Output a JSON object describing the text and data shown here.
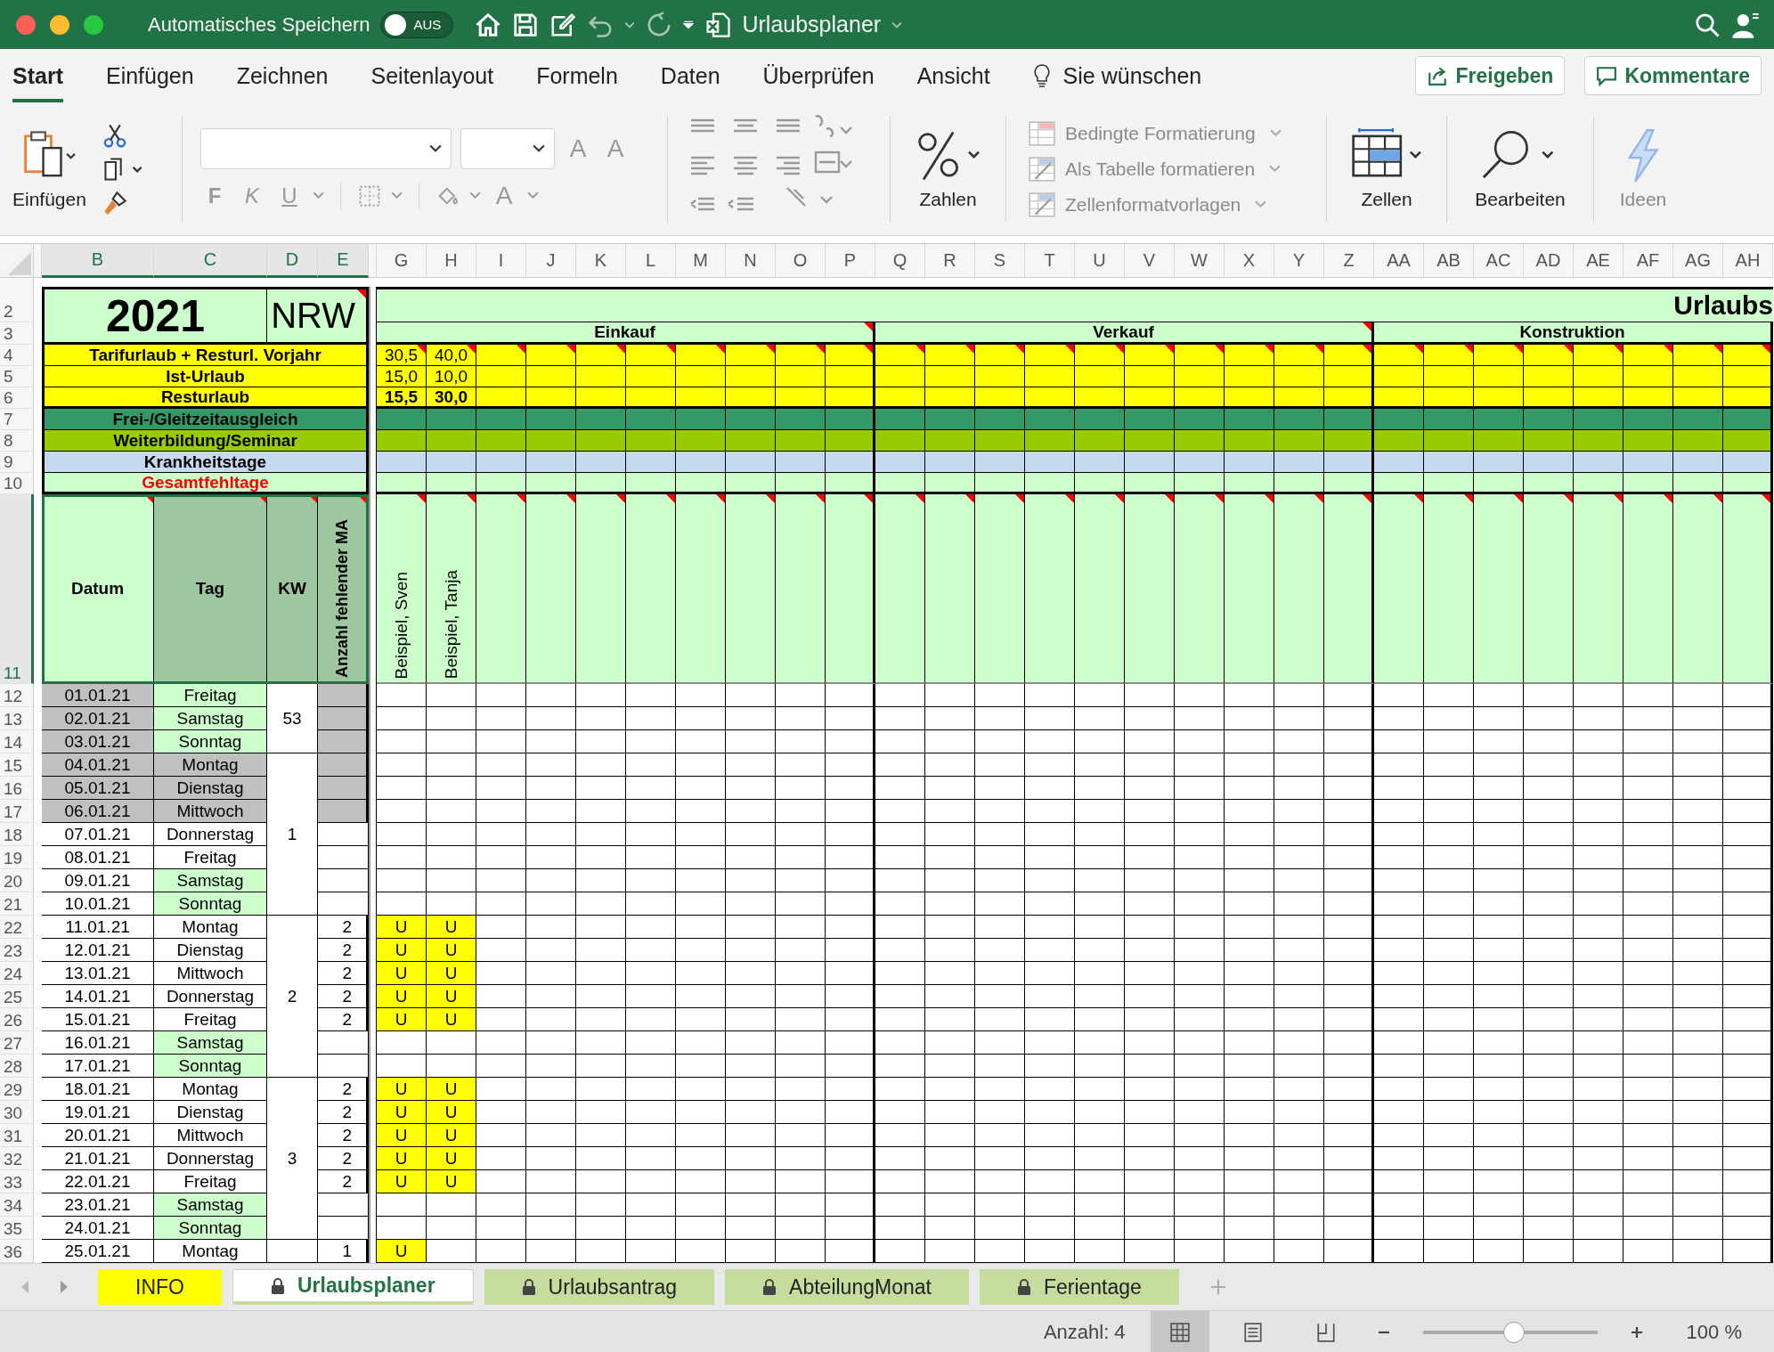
{
  "title_bar": {
    "autosave_label": "Automatisches Speichern",
    "autosave_toggle": {
      "label": "AUS",
      "on": false
    },
    "document_title": "Urlaubsplaner"
  },
  "ribbon_tabs": [
    {
      "label": "Start",
      "selected": true
    },
    {
      "label": "Einfügen",
      "selected": false
    },
    {
      "label": "Zeichnen",
      "selected": false
    },
    {
      "label": "Seitenlayout",
      "selected": false
    },
    {
      "label": "Formeln",
      "selected": false
    },
    {
      "label": "Daten",
      "selected": false
    },
    {
      "label": "Überprüfen",
      "selected": false
    },
    {
      "label": "Ansicht",
      "selected": false
    }
  ],
  "tell_me": "Sie wünschen",
  "share_button": "Freigeben",
  "comments_button": "Kommentare",
  "ribbon": {
    "format_controls_disabled": true,
    "paste_label": "Einfügen",
    "font_style_buttons": [
      "F",
      "K",
      "U"
    ],
    "font_size_buttons": [
      "A",
      "A"
    ],
    "font_color_button": "A",
    "number_label": "Zahlen",
    "styles": [
      "Bedingte Formatierung",
      "Als Tabelle formatieren",
      "Zellenformatvorlagen"
    ],
    "cells_label": "Zellen",
    "edit_label": "Bearbeiten",
    "ideas": {
      "label": "Ideen",
      "disabled": true
    }
  },
  "sheet": {
    "columns": [
      {
        "selected": false
      },
      {
        "letter": "B",
        "selected": true
      },
      {
        "letter": "C",
        "selected": true
      },
      {
        "letter": "D",
        "selected": true
      },
      {
        "letter": "E",
        "selected": true
      },
      {
        "selected": false
      },
      {
        "letter": "G",
        "selected": false
      },
      {
        "letter": "H",
        "selected": false
      },
      {
        "letter": "I",
        "selected": false
      },
      {
        "letter": "J",
        "selected": false
      },
      {
        "letter": "K",
        "selected": false
      },
      {
        "letter": "L",
        "selected": false
      },
      {
        "letter": "M",
        "selected": false
      },
      {
        "letter": "N",
        "selected": false
      },
      {
        "letter": "O",
        "selected": false
      },
      {
        "letter": "P",
        "selected": false
      },
      {
        "letter": "Q",
        "selected": false
      },
      {
        "letter": "R",
        "selected": false
      },
      {
        "letter": "S",
        "selected": false
      },
      {
        "letter": "T",
        "selected": false
      },
      {
        "letter": "U",
        "selected": false
      },
      {
        "letter": "V",
        "selected": false
      },
      {
        "letter": "W",
        "selected": false
      },
      {
        "letter": "X",
        "selected": false
      },
      {
        "letter": "Y",
        "selected": false
      },
      {
        "letter": "Z",
        "selected": false
      },
      {
        "letter": "AA",
        "selected": false
      },
      {
        "letter": "AB",
        "selected": false
      },
      {
        "letter": "AC",
        "selected": false
      },
      {
        "letter": "AD",
        "selected": false
      },
      {
        "letter": "AE",
        "selected": false
      },
      {
        "letter": "AF",
        "selected": false
      },
      {
        "letter": "AG",
        "selected": false
      },
      {
        "letter": "AH",
        "selected": false
      }
    ],
    "row_headers": [
      {
        "number": "2",
        "selected": false
      },
      {
        "number": "3",
        "selected": false
      },
      {
        "number": "4",
        "selected": false
      },
      {
        "number": "5",
        "selected": false
      },
      {
        "number": "6",
        "selected": false
      },
      {
        "number": "7",
        "selected": false
      },
      {
        "number": "8",
        "selected": false
      },
      {
        "number": "9",
        "selected": false
      },
      {
        "number": "10",
        "selected": false
      },
      {
        "number": "11",
        "selected": true
      },
      {
        "number": "12",
        "selected": false
      },
      {
        "number": "13",
        "selected": false
      },
      {
        "number": "14",
        "selected": false
      },
      {
        "number": "15",
        "selected": false
      },
      {
        "number": "16",
        "selected": false
      },
      {
        "number": "17",
        "selected": false
      },
      {
        "number": "18",
        "selected": false
      },
      {
        "number": "19",
        "selected": false
      },
      {
        "number": "20",
        "selected": false
      },
      {
        "number": "21",
        "selected": false
      },
      {
        "number": "22",
        "selected": false
      },
      {
        "number": "23",
        "selected": false
      },
      {
        "number": "24",
        "selected": false
      },
      {
        "number": "25",
        "selected": false
      },
      {
        "number": "26",
        "selected": false
      },
      {
        "number": "27",
        "selected": false
      },
      {
        "number": "28",
        "selected": false
      },
      {
        "number": "29",
        "selected": false
      },
      {
        "number": "30",
        "selected": false
      },
      {
        "number": "31",
        "selected": false
      },
      {
        "number": "32",
        "selected": false
      },
      {
        "number": "33",
        "selected": false
      },
      {
        "number": "34",
        "selected": false
      },
      {
        "number": "35",
        "selected": false
      },
      {
        "number": "36",
        "selected": false
      }
    ],
    "year": "2021",
    "state": "NRW",
    "state_comment": true,
    "plan_title": "Urlaubs",
    "summary_rows": [
      {
        "label": "Tarifurlaub + Resturl. Vorjahr",
        "kind": "entitlement"
      },
      {
        "label": "Ist-Urlaub",
        "kind": "taken"
      },
      {
        "label": "Resturlaub",
        "kind": "remaining"
      },
      {
        "label": "Frei-/Gleitzeitausgleich",
        "kind": "flextime"
      },
      {
        "label": "Weiterbildung/Seminar",
        "kind": "training"
      },
      {
        "label": "Krankheitstage",
        "kind": "sick"
      },
      {
        "label": "Gesamtfehltage",
        "kind": "total"
      }
    ],
    "list_headers": [
      {
        "label": "Datum",
        "kind": "date",
        "comment": true
      },
      {
        "label": "Tag",
        "kind": "day",
        "comment": true
      },
      {
        "label": "KW",
        "kind": "week",
        "comment": true
      },
      {
        "label": "Anzahl fehlender MA",
        "kind": "count",
        "comment": true
      }
    ],
    "departments": [
      {
        "name": "Einkauf",
        "comment": true,
        "columns": [
          {
            "name": "Beispiel, Sven",
            "values": [
              "30,5",
              "15,0",
              "15,5"
            ],
            "comment": true
          },
          {
            "name": "Beispiel, Tanja",
            "values": [
              "40,0",
              "10,0",
              "30,0"
            ],
            "comment": true
          },
          {
            "comment": true
          },
          {
            "comment": true
          },
          {
            "comment": true
          },
          {
            "comment": true
          },
          {
            "comment": true
          },
          {
            "comment": true
          },
          {
            "comment": true
          },
          {
            "comment": true
          }
        ]
      },
      {
        "name": "Verkauf",
        "comment": true,
        "columns": [
          {
            "comment": true
          },
          {
            "comment": true
          },
          {
            "comment": true
          },
          {
            "comment": true
          },
          {
            "comment": true
          },
          {
            "comment": true
          },
          {
            "comment": true
          },
          {
            "comment": true
          },
          {
            "comment": true
          },
          {
            "comment": true
          }
        ]
      },
      {
        "name": "Konstruktion",
        "comment": false,
        "columns": [
          {
            "comment": true
          },
          {
            "comment": true
          },
          {
            "comment": true
          },
          {
            "comment": true
          },
          {
            "comment": true
          },
          {
            "comment": true
          },
          {
            "comment": true
          },
          {
            "comment": true
          }
        ]
      }
    ],
    "weeks": [
      {
        "number": "53",
        "days": [
          {
            "date": "01.01.21",
            "day": "Freitag",
            "kind": "holiday",
            "shaded": true
          },
          {
            "date": "02.01.21",
            "day": "Samstag",
            "kind": "weekend",
            "shaded": true
          },
          {
            "date": "03.01.21",
            "day": "Sonntag",
            "kind": "weekend",
            "shaded": true
          }
        ]
      },
      {
        "number": "1",
        "days": [
          {
            "date": "04.01.21",
            "day": "Montag",
            "kind": "closed",
            "shaded": true
          },
          {
            "date": "05.01.21",
            "day": "Dienstag",
            "kind": "closed",
            "shaded": true
          },
          {
            "date": "06.01.21",
            "day": "Mittwoch",
            "kind": "closed",
            "shaded": true
          },
          {
            "date": "07.01.21",
            "day": "Donnerstag",
            "kind": "workday",
            "shaded": false
          },
          {
            "date": "08.01.21",
            "day": "Freitag",
            "kind": "workday",
            "shaded": false
          },
          {
            "date": "09.01.21",
            "day": "Samstag",
            "kind": "weekend",
            "shaded": false
          },
          {
            "date": "10.01.21",
            "day": "Sonntag",
            "kind": "weekend",
            "shaded": false
          }
        ]
      },
      {
        "number": "2",
        "days": [
          {
            "date": "11.01.21",
            "day": "Montag",
            "kind": "workday",
            "shaded": false,
            "absent": "2",
            "entries": [
              "U",
              "U"
            ]
          },
          {
            "date": "12.01.21",
            "day": "Dienstag",
            "kind": "workday",
            "shaded": false,
            "absent": "2",
            "entries": [
              "U",
              "U"
            ]
          },
          {
            "date": "13.01.21",
            "day": "Mittwoch",
            "kind": "workday",
            "shaded": false,
            "absent": "2",
            "entries": [
              "U",
              "U"
            ]
          },
          {
            "date": "14.01.21",
            "day": "Donnerstag",
            "kind": "workday",
            "shaded": false,
            "absent": "2",
            "entries": [
              "U",
              "U"
            ]
          },
          {
            "date": "15.01.21",
            "day": "Freitag",
            "kind": "workday",
            "shaded": false,
            "absent": "2",
            "entries": [
              "U",
              "U"
            ]
          },
          {
            "date": "16.01.21",
            "day": "Samstag",
            "kind": "weekend",
            "shaded": false
          },
          {
            "date": "17.01.21",
            "day": "Sonntag",
            "kind": "weekend",
            "shaded": false
          }
        ]
      },
      {
        "number": "3",
        "days": [
          {
            "date": "18.01.21",
            "day": "Montag",
            "kind": "workday",
            "shaded": false,
            "absent": "2",
            "entries": [
              "U",
              "U"
            ]
          },
          {
            "date": "19.01.21",
            "day": "Dienstag",
            "kind": "workday",
            "shaded": false,
            "absent": "2",
            "entries": [
              "U",
              "U"
            ]
          },
          {
            "date": "20.01.21",
            "day": "Mittwoch",
            "kind": "workday",
            "shaded": false,
            "absent": "2",
            "entries": [
              "U",
              "U"
            ]
          },
          {
            "date": "21.01.21",
            "day": "Donnerstag",
            "kind": "workday",
            "shaded": false,
            "absent": "2",
            "entries": [
              "U",
              "U"
            ]
          },
          {
            "date": "22.01.21",
            "day": "Freitag",
            "kind": "workday",
            "shaded": false,
            "absent": "2",
            "entries": [
              "U",
              "U"
            ]
          },
          {
            "date": "23.01.21",
            "day": "Samstag",
            "kind": "weekend",
            "shaded": false
          },
          {
            "date": "24.01.21",
            "day": "Sonntag",
            "kind": "weekend",
            "shaded": false
          }
        ]
      },
      {
        "days": [
          {
            "date": "25.01.21",
            "day": "Montag",
            "kind": "workday",
            "shaded": false,
            "absent": "1",
            "entries": [
              "U"
            ]
          }
        ]
      }
    ]
  },
  "sheet_tabs": [
    {
      "label": "INFO",
      "color": "#ffff00",
      "locked": false,
      "selected": false
    },
    {
      "label": "Urlaubsplaner",
      "color": "#c5dc9c",
      "locked": true,
      "selected": true
    },
    {
      "label": "Urlaubsantrag",
      "color": "#c5dc9c",
      "locked": true,
      "selected": false
    },
    {
      "label": "AbteilungMonat",
      "color": "#c5dc9c",
      "locked": true,
      "selected": false
    },
    {
      "label": "Ferientage",
      "color": "#c5dc9c",
      "locked": true,
      "selected": false
    }
  ],
  "status_bar": {
    "count": "Anzahl: 4",
    "views": [
      {
        "kind": "normal",
        "selected": true
      },
      {
        "kind": "page_layout",
        "selected": false
      },
      {
        "kind": "page_break",
        "selected": false
      }
    ],
    "zoom_slider": {
      "level": 0.52
    },
    "zoom": "100 %"
  }
}
